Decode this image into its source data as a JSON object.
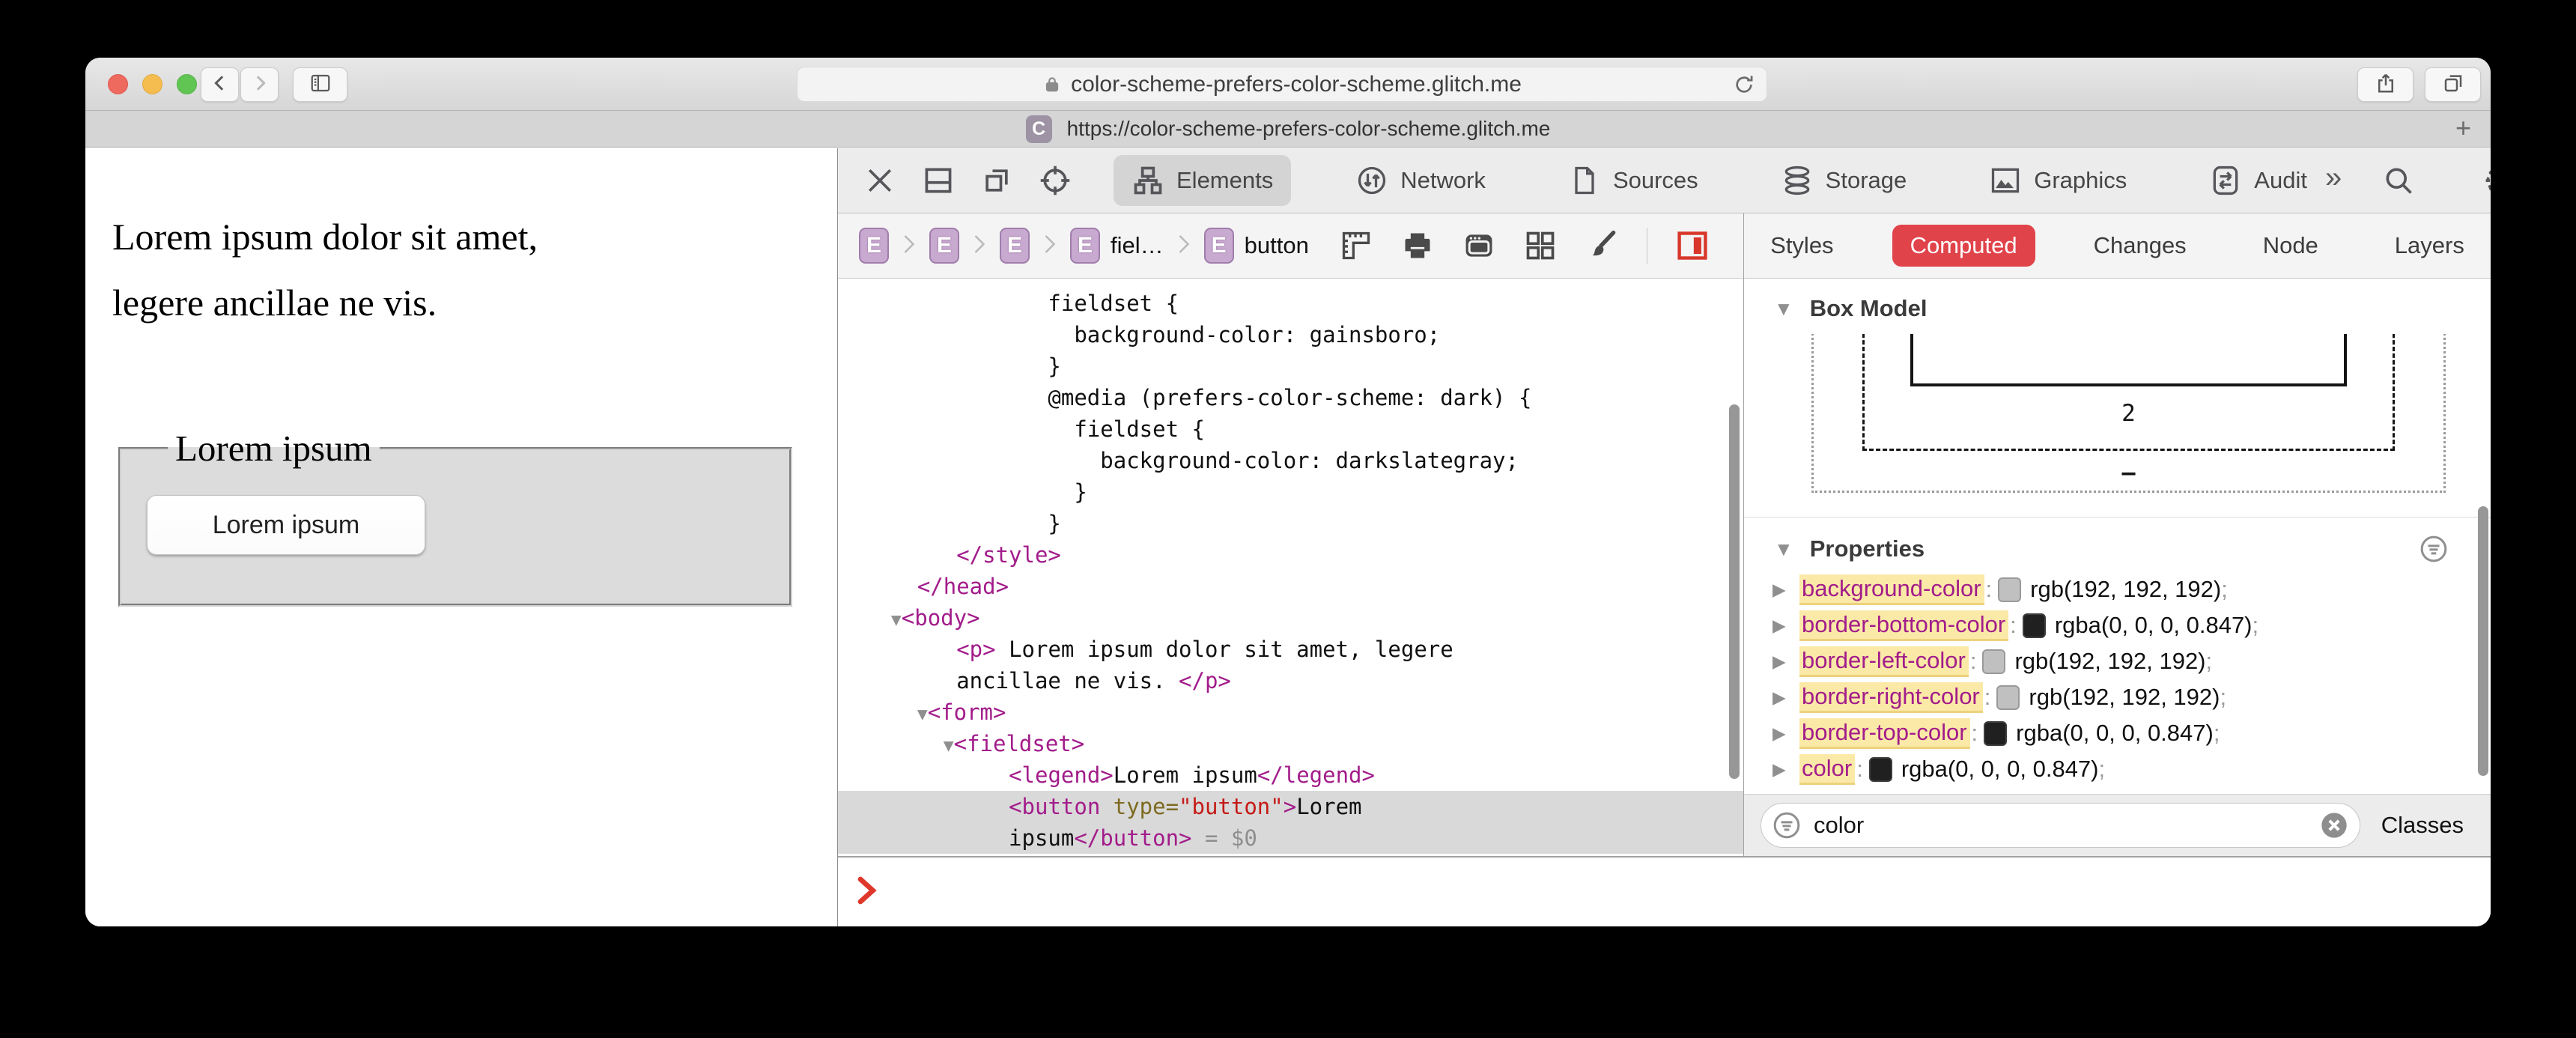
{
  "toolbar": {
    "url_domain": "color-scheme-prefers-color-scheme.glitch.me"
  },
  "tab_bar": {
    "tab_title": "https://color-scheme-prefers-color-scheme.glitch.me",
    "favicon_letter": "C",
    "new_tab_glyph": "+"
  },
  "page": {
    "paragraph_line1": "Lorem ipsum dolor sit amet,",
    "paragraph_line2": "legere ancillae ne vis.",
    "legend": "Lorem ipsum",
    "button_label": "Lorem ipsum"
  },
  "inspector": {
    "tabs": [
      {
        "label": "Elements",
        "icon": "elements",
        "active": true
      },
      {
        "label": "Network",
        "icon": "network",
        "active": false
      },
      {
        "label": "Sources",
        "icon": "document",
        "active": false
      },
      {
        "label": "Storage",
        "icon": "database",
        "active": false
      },
      {
        "label": "Graphics",
        "icon": "image",
        "active": false
      },
      {
        "label": "Audit",
        "icon": "audit",
        "active": false
      }
    ],
    "more_tabs_glyph": "»",
    "breadcrumb": {
      "badge_letter": "E",
      "items": [
        {
          "label": ""
        },
        {
          "label": ""
        },
        {
          "label": ""
        },
        {
          "label": "fiel…"
        },
        {
          "label": "button"
        }
      ]
    },
    "code": {
      "lines": [
        {
          "sel": false,
          "segs": [
            {
              "t": "              fieldset {",
              "c": "plain"
            }
          ]
        },
        {
          "sel": false,
          "segs": [
            {
              "t": "                background-color: gainsboro;",
              "c": "plain"
            }
          ]
        },
        {
          "sel": false,
          "segs": [
            {
              "t": "              }",
              "c": "plain"
            }
          ]
        },
        {
          "sel": false,
          "segs": [
            {
              "t": "              @media (prefers-color-scheme: dark) {",
              "c": "plain"
            }
          ]
        },
        {
          "sel": false,
          "segs": [
            {
              "t": "                fieldset {",
              "c": "plain"
            }
          ]
        },
        {
          "sel": false,
          "segs": [
            {
              "t": "                  background-color: darkslategray;",
              "c": "plain"
            }
          ]
        },
        {
          "sel": false,
          "segs": [
            {
              "t": "                }",
              "c": "plain"
            }
          ]
        },
        {
          "sel": false,
          "segs": [
            {
              "t": "              }",
              "c": "plain"
            }
          ]
        },
        {
          "sel": false,
          "segs": [
            {
              "t": "       ",
              "c": "plain"
            },
            {
              "t": "</style>",
              "c": "tag"
            }
          ]
        },
        {
          "sel": false,
          "segs": [
            {
              "t": "    ",
              "c": "plain"
            },
            {
              "t": "</head>",
              "c": "tag"
            }
          ]
        },
        {
          "sel": false,
          "segs": [
            {
              "t": "  ",
              "c": "plain"
            },
            {
              "t": "▼",
              "c": "tri"
            },
            {
              "t": "<body>",
              "c": "tag"
            }
          ]
        },
        {
          "sel": false,
          "segs": [
            {
              "t": "       ",
              "c": "plain"
            },
            {
              "t": "<p>",
              "c": "tag"
            },
            {
              "t": " Lorem ipsum dolor sit amet, legere",
              "c": "plain"
            }
          ]
        },
        {
          "sel": false,
          "segs": [
            {
              "t": "       ancillae ne vis. ",
              "c": "plain"
            },
            {
              "t": "</p>",
              "c": "tag"
            }
          ]
        },
        {
          "sel": false,
          "segs": [
            {
              "t": "    ",
              "c": "plain"
            },
            {
              "t": "▼",
              "c": "tri"
            },
            {
              "t": "<form>",
              "c": "tag"
            }
          ]
        },
        {
          "sel": false,
          "segs": [
            {
              "t": "      ",
              "c": "plain"
            },
            {
              "t": "▼",
              "c": "tri"
            },
            {
              "t": "<fieldset>",
              "c": "tag"
            }
          ]
        },
        {
          "sel": false,
          "segs": [
            {
              "t": "           ",
              "c": "plain"
            },
            {
              "t": "<legend>",
              "c": "tag"
            },
            {
              "t": "Lorem ipsum",
              "c": "plain"
            },
            {
              "t": "</legend>",
              "c": "tag"
            }
          ]
        },
        {
          "sel": true,
          "segs": [
            {
              "t": "           ",
              "c": "plain"
            },
            {
              "t": "<button",
              "c": "tag"
            },
            {
              "t": " type=",
              "c": "attr"
            },
            {
              "t": "\"button\"",
              "c": "val"
            },
            {
              "t": ">",
              "c": "tag"
            },
            {
              "t": "Lorem",
              "c": "plain"
            }
          ]
        },
        {
          "sel": true,
          "segs": [
            {
              "t": "           ipsum",
              "c": "plain"
            },
            {
              "t": "</button>",
              "c": "tag"
            },
            {
              "t": " ",
              "c": "plain"
            },
            {
              "t": "= $0",
              "c": "meta"
            }
          ]
        }
      ]
    },
    "sidebar": {
      "tabs": [
        {
          "label": "Styles",
          "active": false
        },
        {
          "label": "Computed",
          "active": true
        },
        {
          "label": "Changes",
          "active": false
        },
        {
          "label": "Node",
          "active": false
        },
        {
          "label": "Layers",
          "active": false
        }
      ],
      "box_model": {
        "title": "Box Model",
        "disclosure": "▼",
        "bottom_border_width": "2",
        "dash": "–"
      },
      "properties": {
        "title": "Properties",
        "disclosure": "▼",
        "rows": [
          {
            "name": "background-color",
            "swatch": "#c0c0c0",
            "dark": false,
            "value": "rgb(192, 192, 192)"
          },
          {
            "name": "border-bottom-color",
            "swatch": "#202020",
            "dark": true,
            "value": "rgba(0, 0, 0, 0.847)"
          },
          {
            "name": "border-left-color",
            "swatch": "#c0c0c0",
            "dark": false,
            "value": "rgb(192, 192, 192)"
          },
          {
            "name": "border-right-color",
            "swatch": "#c0c0c0",
            "dark": false,
            "value": "rgb(192, 192, 192)"
          },
          {
            "name": "border-top-color",
            "swatch": "#202020",
            "dark": true,
            "value": "rgba(0, 0, 0, 0.847)"
          },
          {
            "name": "color",
            "swatch": "#202020",
            "dark": true,
            "value": "rgba(0, 0, 0, 0.847)"
          }
        ]
      },
      "filter": {
        "value": "color",
        "classes_label": "Classes"
      }
    }
  },
  "colors": {
    "computed_tab_active": "#e0434a",
    "tag_magenta": "#a21c8a",
    "attr_name_olive": "#7d6a21",
    "attr_value_red": "#c41a16",
    "search_highlight_yellow": "#fbe9a8",
    "selected_row_gray": "#d9d9d9",
    "fieldset_gainsboro": "#dcdcdc",
    "prompt_red": "#e0372b",
    "traffic_red": "#ee6a5f",
    "traffic_yellow": "#f5bd4f",
    "traffic_green": "#61c554",
    "badge_purple": "#c8a9cf"
  }
}
